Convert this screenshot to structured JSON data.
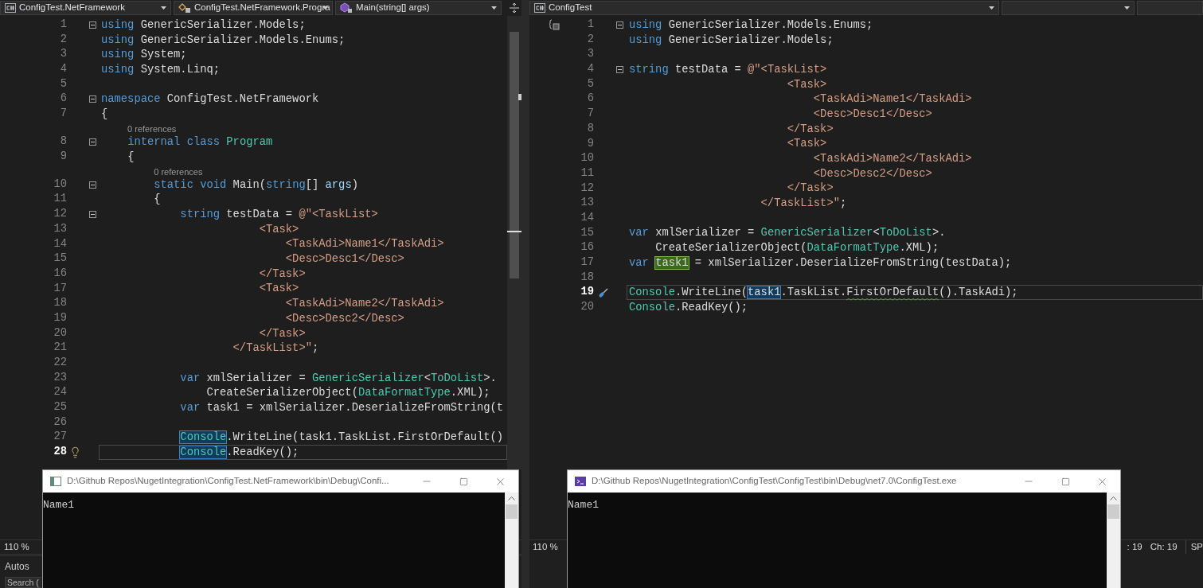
{
  "left_editor": {
    "nav": [
      {
        "text": "ConfigTest.NetFramework",
        "caret": true
      },
      {
        "text": "ConfigTest.NetFramework.Progra",
        "caret": true
      },
      {
        "text": "Main(string[] args)",
        "caret": true
      }
    ],
    "lines": [
      {
        "kind": "code",
        "number": "1",
        "fold": true,
        "current": false,
        "tokens": [
          {
            "text": "using",
            "kind": "keyword"
          },
          {
            "text": " GenericSerializer.Models;",
            "kind": "plain"
          }
        ]
      },
      {
        "kind": "code",
        "number": "2",
        "fold": false,
        "current": false,
        "tokens": [
          {
            "text": "using",
            "kind": "keyword"
          },
          {
            "text": " GenericSerializer.Models.Enums;",
            "kind": "plain"
          }
        ]
      },
      {
        "kind": "code",
        "number": "3",
        "fold": false,
        "current": false,
        "tokens": [
          {
            "text": "using",
            "kind": "keyword"
          },
          {
            "text": " System;",
            "kind": "plain"
          }
        ]
      },
      {
        "kind": "code",
        "number": "4",
        "fold": false,
        "current": false,
        "tokens": [
          {
            "text": "using",
            "kind": "keyword"
          },
          {
            "text": " System.Linq;",
            "kind": "plain"
          }
        ]
      },
      {
        "kind": "code",
        "number": "5",
        "fold": false,
        "current": false
      },
      {
        "kind": "code",
        "number": "6",
        "fold": true,
        "current": false,
        "tokens": [
          {
            "text": "namespace",
            "kind": "keyword"
          },
          {
            "text": " ConfigTest.NetFramework",
            "kind": "plain"
          }
        ]
      },
      {
        "kind": "code",
        "number": "7",
        "fold": false,
        "current": false,
        "tokens": [
          {
            "text": "{",
            "kind": "plain"
          }
        ]
      },
      {
        "kind": "lens",
        "text": "0 references"
      },
      {
        "kind": "code",
        "number": "8",
        "fold": true,
        "current": false,
        "tokens": [
          {
            "text": "    internal class",
            "kind": "keyword"
          },
          {
            "text": " Program",
            "kind": "type"
          }
        ]
      },
      {
        "kind": "code",
        "number": "9",
        "fold": false,
        "current": false,
        "tokens": [
          {
            "text": "    {",
            "kind": "plain"
          }
        ]
      },
      {
        "kind": "lens",
        "text": "0 references"
      },
      {
        "kind": "code",
        "number": "10",
        "fold": true,
        "current": false,
        "tokens": [
          {
            "text": "        static void",
            "kind": "keyword"
          },
          {
            "text": " Main(",
            "kind": "plain"
          },
          {
            "text": "string",
            "kind": "keyword"
          },
          {
            "text": "[] ",
            "kind": "plain"
          },
          {
            "text": "args",
            "kind": "parameter"
          },
          {
            "text": ")",
            "kind": "plain"
          }
        ]
      },
      {
        "kind": "code",
        "number": "11",
        "fold": false,
        "current": false,
        "tokens": [
          {
            "text": "        {",
            "kind": "plain"
          }
        ]
      },
      {
        "kind": "code",
        "number": "12",
        "fold": true,
        "current": false,
        "tokens": [
          {
            "text": "            string",
            "kind": "keyword"
          },
          {
            "text": " testData = ",
            "kind": "plain"
          },
          {
            "text": "@\"<TaskList>",
            "kind": "string"
          }
        ]
      },
      {
        "kind": "code",
        "number": "13",
        "fold": false,
        "current": false,
        "tokens": [
          {
            "text": "                        <Task>",
            "kind": "string"
          }
        ]
      },
      {
        "kind": "code",
        "number": "14",
        "fold": false,
        "current": false,
        "tokens": [
          {
            "text": "                            <TaskAdi>Name1</TaskAdi>",
            "kind": "string"
          }
        ]
      },
      {
        "kind": "code",
        "number": "15",
        "fold": false,
        "current": false,
        "tokens": [
          {
            "text": "                            <Desc>Desc1</Desc>",
            "kind": "string"
          }
        ]
      },
      {
        "kind": "code",
        "number": "16",
        "fold": false,
        "current": false,
        "tokens": [
          {
            "text": "                        </Task>",
            "kind": "string"
          }
        ]
      },
      {
        "kind": "code",
        "number": "17",
        "fold": false,
        "current": false,
        "tokens": [
          {
            "text": "                        <Task>",
            "kind": "string"
          }
        ]
      },
      {
        "kind": "code",
        "number": "18",
        "fold": false,
        "current": false,
        "tokens": [
          {
            "text": "                            <TaskAdi>Name2</TaskAdi>",
            "kind": "string"
          }
        ]
      },
      {
        "kind": "code",
        "number": "19",
        "fold": false,
        "current": false,
        "tokens": [
          {
            "text": "                            <Desc>Desc2</Desc>",
            "kind": "string"
          }
        ]
      },
      {
        "kind": "code",
        "number": "20",
        "fold": false,
        "current": false,
        "tokens": [
          {
            "text": "                        </Task>",
            "kind": "string"
          }
        ]
      },
      {
        "kind": "code",
        "number": "21",
        "fold": false,
        "current": false,
        "tokens": [
          {
            "text": "                    </TaskList>\"",
            "kind": "string"
          },
          {
            "text": ";",
            "kind": "plain"
          }
        ]
      },
      {
        "kind": "code",
        "number": "22",
        "fold": false,
        "current": false
      },
      {
        "kind": "code",
        "number": "23",
        "fold": false,
        "current": false,
        "tokens": [
          {
            "text": "            var",
            "kind": "keyword"
          },
          {
            "text": " xmlSerializer = ",
            "kind": "plain"
          },
          {
            "text": "GenericSerializer",
            "kind": "type"
          },
          {
            "text": "<",
            "kind": "plain"
          },
          {
            "text": "ToDoList",
            "kind": "type"
          },
          {
            "text": ">.",
            "kind": "plain"
          }
        ]
      },
      {
        "kind": "code",
        "number": "24",
        "fold": false,
        "current": false,
        "tokens": [
          {
            "text": "                CreateSerializerObject(",
            "kind": "plain"
          },
          {
            "text": "DataFormatType",
            "kind": "type"
          },
          {
            "text": ".XML);",
            "kind": "plain"
          }
        ]
      },
      {
        "kind": "code",
        "number": "25",
        "fold": false,
        "current": false,
        "tokens": [
          {
            "text": "            var",
            "kind": "keyword"
          },
          {
            "text": " task1 = xmlSerializer.DeserializeFromString(t",
            "kind": "plain"
          }
        ]
      },
      {
        "kind": "code",
        "number": "26",
        "fold": false,
        "current": false
      },
      {
        "kind": "code",
        "number": "27",
        "fold": false,
        "current": false,
        "tokens": [
          {
            "text": "            Console",
            "kind": "type",
            "highlighted": true
          },
          {
            "text": ".WriteLine(task1.TaskList.FirstOrDefault()",
            "kind": "plain"
          }
        ]
      },
      {
        "kind": "code",
        "number": "28",
        "fold": false,
        "current": true,
        "tokens": [
          {
            "text": "            Console",
            "kind": "type",
            "highlighted": true
          },
          {
            "text": ".ReadKey();",
            "kind": "plain"
          }
        ]
      }
    ],
    "status": {
      "zoom": "110 %"
    }
  },
  "right_editor": {
    "nav": [
      {
        "text": "ConfigTest",
        "caret": true
      },
      {
        "caret": true
      },
      {
        "caret": false
      }
    ],
    "lines": [
      {
        "kind": "code",
        "number": "1",
        "fold": true,
        "current": false,
        "tokens": [
          {
            "text": "using",
            "kind": "keyword"
          },
          {
            "text": " GenericSerializer.Models.Enums;",
            "kind": "plain"
          }
        ]
      },
      {
        "kind": "code",
        "number": "2",
        "fold": false,
        "current": false,
        "tokens": [
          {
            "text": "using",
            "kind": "keyword"
          },
          {
            "text": " GenericSerializer.Models;",
            "kind": "plain"
          }
        ]
      },
      {
        "kind": "code",
        "number": "3",
        "fold": false,
        "current": false
      },
      {
        "kind": "code",
        "number": "4",
        "fold": true,
        "current": false,
        "tokens": [
          {
            "text": "string",
            "kind": "keyword"
          },
          {
            "text": " testData = ",
            "kind": "plain"
          },
          {
            "text": "@\"<TaskList>",
            "kind": "string"
          }
        ]
      },
      {
        "kind": "code",
        "number": "5",
        "fold": false,
        "current": false,
        "tokens": [
          {
            "text": "                        <Task>",
            "kind": "string"
          }
        ]
      },
      {
        "kind": "code",
        "number": "6",
        "fold": false,
        "current": false,
        "tokens": [
          {
            "text": "                            <TaskAdi>Name1</TaskAdi>",
            "kind": "string"
          }
        ]
      },
      {
        "kind": "code",
        "number": "7",
        "fold": false,
        "current": false,
        "tokens": [
          {
            "text": "                            <Desc>Desc1</Desc>",
            "kind": "string"
          }
        ]
      },
      {
        "kind": "code",
        "number": "8",
        "fold": false,
        "current": false,
        "tokens": [
          {
            "text": "                        </Task>",
            "kind": "string"
          }
        ]
      },
      {
        "kind": "code",
        "number": "9",
        "fold": false,
        "current": false,
        "tokens": [
          {
            "text": "                        <Task>",
            "kind": "string"
          }
        ]
      },
      {
        "kind": "code",
        "number": "10",
        "fold": false,
        "current": false,
        "tokens": [
          {
            "text": "                            <TaskAdi>Name2</TaskAdi>",
            "kind": "string"
          }
        ]
      },
      {
        "kind": "code",
        "number": "11",
        "fold": false,
        "current": false,
        "tokens": [
          {
            "text": "                            <Desc>Desc2</Desc>",
            "kind": "string"
          }
        ]
      },
      {
        "kind": "code",
        "number": "12",
        "fold": false,
        "current": false,
        "tokens": [
          {
            "text": "                        </Task>",
            "kind": "string"
          }
        ]
      },
      {
        "kind": "code",
        "number": "13",
        "fold": false,
        "current": false,
        "tokens": [
          {
            "text": "                    </TaskList>\"",
            "kind": "string"
          },
          {
            "text": ";",
            "kind": "plain"
          }
        ]
      },
      {
        "kind": "code",
        "number": "14",
        "fold": false,
        "current": false
      },
      {
        "kind": "code",
        "number": "15",
        "fold": false,
        "current": false,
        "tokens": [
          {
            "text": "var",
            "kind": "keyword"
          },
          {
            "text": " xmlSerializer = ",
            "kind": "plain"
          },
          {
            "text": "GenericSerializer",
            "kind": "type"
          },
          {
            "text": "<",
            "kind": "plain"
          },
          {
            "text": "ToDoList",
            "kind": "type"
          },
          {
            "text": ">.",
            "kind": "plain"
          }
        ]
      },
      {
        "kind": "code",
        "number": "16",
        "fold": false,
        "current": false,
        "tokens": [
          {
            "text": "    CreateSerializerObject(",
            "kind": "plain"
          },
          {
            "text": "DataFormatType",
            "kind": "type"
          },
          {
            "text": ".XML);",
            "kind": "plain"
          }
        ]
      },
      {
        "kind": "code",
        "number": "17",
        "fold": false,
        "current": false,
        "tokens": [
          {
            "text": "var",
            "kind": "keyword"
          },
          {
            "text": " task1",
            "kind": "plain",
            "highlighted": true,
            "assignment": true
          },
          {
            "text": " = xmlSerializer.DeserializeFromString(testData);",
            "kind": "plain"
          }
        ]
      },
      {
        "kind": "code",
        "number": "18",
        "fold": false,
        "current": false
      },
      {
        "kind": "code",
        "number": "19",
        "fold": false,
        "current": true,
        "tokens": [
          {
            "text": "Console",
            "kind": "type"
          },
          {
            "text": ".WriteLine(",
            "kind": "plain"
          },
          {
            "text": "task1",
            "kind": "plain",
            "highlighted": true
          },
          {
            "text": ".TaskList.",
            "kind": "plain"
          },
          {
            "text": "FirstOrDefault",
            "kind": "plain",
            "warning": true
          },
          {
            "text": "().TaskAdi);",
            "kind": "plain"
          }
        ]
      },
      {
        "kind": "code",
        "number": "20",
        "fold": false,
        "current": false,
        "tokens": [
          {
            "text": "Console",
            "kind": "type"
          },
          {
            "text": ".ReadKey();",
            "kind": "plain"
          }
        ]
      }
    ],
    "status": {
      "zoom": "110 %",
      "items": [
        ": 19",
        "Ch: 19",
        "SP"
      ]
    }
  },
  "autos": {
    "title": "Autos",
    "search_placeholder": "Search ("
  },
  "consoles": [
    {
      "title": "D:\\Github Repos\\NugetIntegration\\ConfigTest.NetFramework\\bin\\Debug\\Confi...",
      "output": "Name1"
    },
    {
      "title": "D:\\Github Repos\\NugetIntegration\\ConfigTest\\ConfigTest\\bin\\Debug\\net7.0\\ConfigTest.exe",
      "output": "Name1"
    }
  ]
}
